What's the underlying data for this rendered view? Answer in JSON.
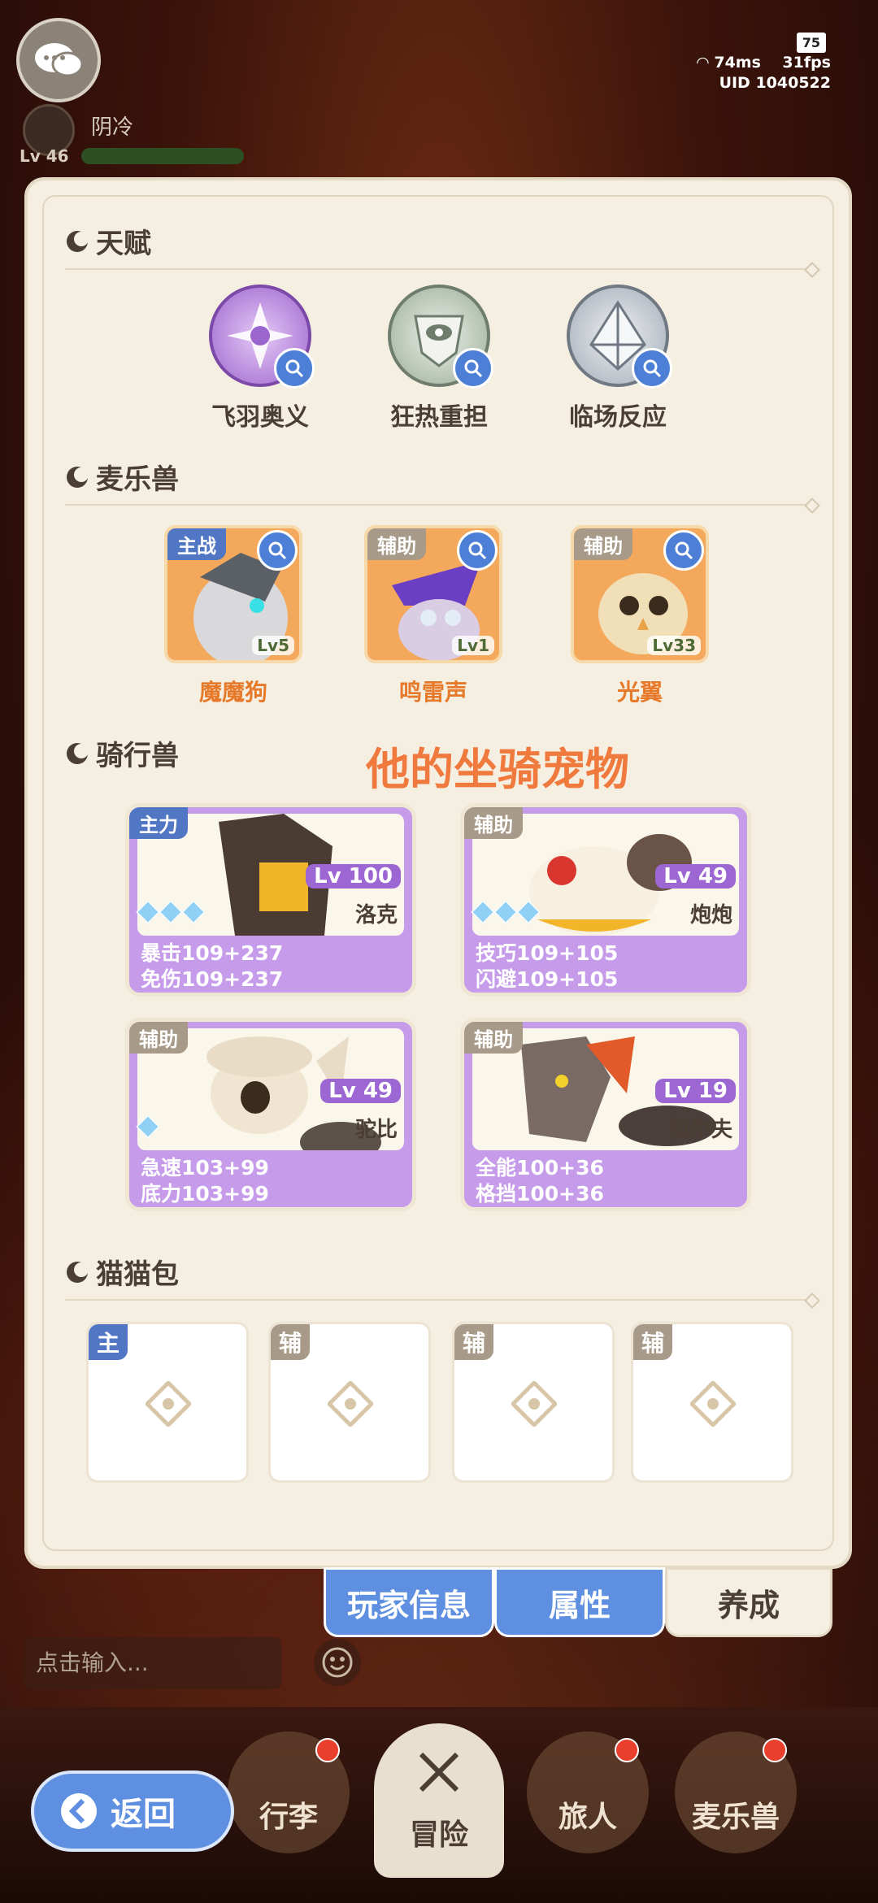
{
  "hud": {
    "player_name": "阴冷",
    "level": "Lv 46",
    "battery": "75",
    "ping": "74ms",
    "fps": "31fps",
    "uid": "UID 1040522"
  },
  "talents": {
    "title": "天赋",
    "items": [
      {
        "label": "飞羽奥义",
        "icon": "shuriken-icon",
        "color": "#c99be8"
      },
      {
        "label": "狂热重担",
        "icon": "eye-shield-icon",
        "color": "#b9c7b5"
      },
      {
        "label": "临场反应",
        "icon": "diamond-crest-icon",
        "color": "#bfc5cc"
      }
    ]
  },
  "pets": {
    "title": "麦乐兽",
    "items": [
      {
        "tag": "主战",
        "level": "Lv5",
        "name": "魔魔狗",
        "tag_type": "main"
      },
      {
        "tag": "辅助",
        "level": "Lv1",
        "name": "鸣雷声",
        "tag_type": "sub"
      },
      {
        "tag": "辅助",
        "level": "Lv33",
        "name": "光翼",
        "tag_type": "sub"
      }
    ]
  },
  "annotation": "他的坐骑宠物",
  "mounts": {
    "title": "骑行兽",
    "items": [
      {
        "tag": "主力",
        "level": "Lv 100",
        "name": "洛克",
        "stat1": "暴击109+237",
        "stat2": "免伤109+237",
        "stars": 3
      },
      {
        "tag": "辅助",
        "level": "Lv 49",
        "name": "炮炮",
        "stat1": "技巧109+105",
        "stat2": "闪避109+105",
        "stars": 3
      },
      {
        "tag": "辅助",
        "level": "Lv 49",
        "name": "驼比",
        "stat1": "急速103+99",
        "stat2": "底力103+99",
        "stars": 1
      },
      {
        "tag": "辅助",
        "level": "Lv 19",
        "name": "拉尔夫",
        "stat1": "全能100+36",
        "stat2": "格挡100+36",
        "stars": 0
      }
    ]
  },
  "catbags": {
    "title": "猫猫包",
    "slots": [
      "主",
      "辅",
      "辅",
      "辅"
    ]
  },
  "panel_tabs": [
    "玩家信息",
    "属性",
    "养成"
  ],
  "chat_input": {
    "placeholder": "点击输入..."
  },
  "nav": {
    "back": "返回",
    "items": [
      "行李",
      "冒险",
      "旅人",
      "麦乐兽"
    ]
  }
}
